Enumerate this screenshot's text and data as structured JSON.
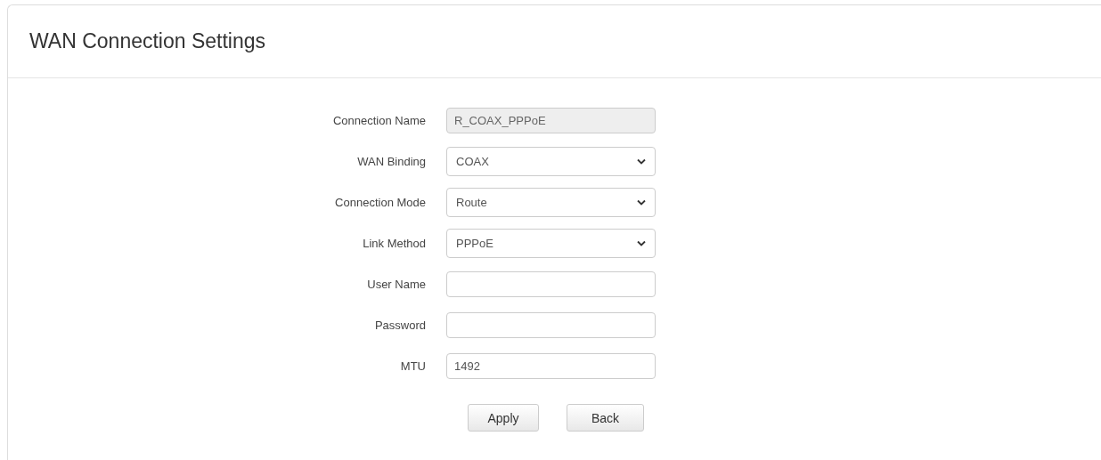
{
  "panel": {
    "title": "WAN Connection Settings"
  },
  "fields": [
    {
      "label": "Connection Name",
      "kind": "text",
      "value": "R_COAX_PPPoE",
      "disabled": true
    },
    {
      "label": "WAN Binding",
      "kind": "select",
      "value": "COAX",
      "disabled": false
    },
    {
      "label": "Connection Mode",
      "kind": "select",
      "value": "Route",
      "disabled": false
    },
    {
      "label": "Link Method",
      "kind": "select",
      "value": "PPPoE",
      "disabled": false
    },
    {
      "label": "User Name",
      "kind": "text",
      "disabled": false
    },
    {
      "label": "Password",
      "kind": "password",
      "disabled": false
    },
    {
      "label": "MTU",
      "kind": "text",
      "value": "1492",
      "disabled": false
    }
  ],
  "buttons": [
    "Apply",
    "Back"
  ]
}
